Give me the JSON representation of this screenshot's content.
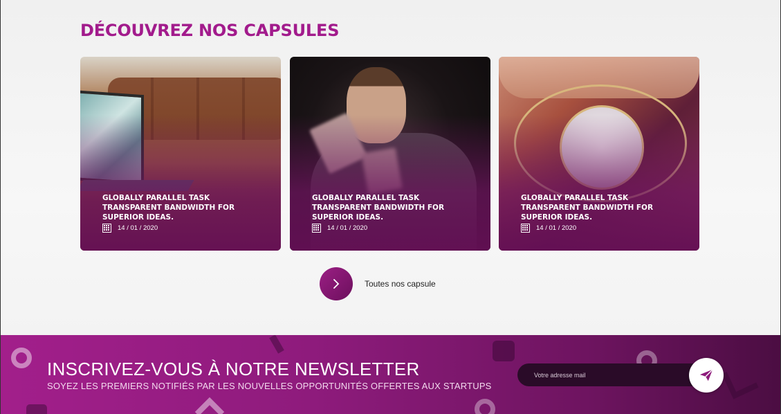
{
  "capsules": {
    "title": "DÉCOUVREZ NOS CAPSULES",
    "cards": [
      {
        "title": "GLOBALLY PARALLEL TASK TRANSPARENT BANDWIDTH FOR SUPERIOR IDEAS.",
        "date": "14 / 01 / 2020"
      },
      {
        "title": "GLOBALLY PARALLEL TASK TRANSPARENT BANDWIDTH FOR SUPERIOR IDEAS.",
        "date": "14 / 01 / 2020"
      },
      {
        "title": "GLOBALLY PARALLEL TASK TRANSPARENT BANDWIDTH FOR SUPERIOR IDEAS.",
        "date": "14 / 01 / 2020"
      }
    ],
    "all_label": "Toutes nos capsule"
  },
  "newsletter": {
    "title": "INSCRIVEZ-VOUS À NOTRE NEWSLETTER",
    "subtitle": "SOYEZ LES PREMIERS NOTIFIÉS PAR LES NOUVELLES OPPORTUNITÉS OFFERTES AUX STARTUPS",
    "email_placeholder": "Votre adresse mail"
  },
  "icons": {
    "calendar": "calendar-icon",
    "chevron": "chevron-right-icon",
    "send": "paper-plane-icon"
  },
  "colors": {
    "accent": "#a21b8c",
    "newsletter_start": "#a21f8b",
    "newsletter_end": "#4b0d42"
  }
}
